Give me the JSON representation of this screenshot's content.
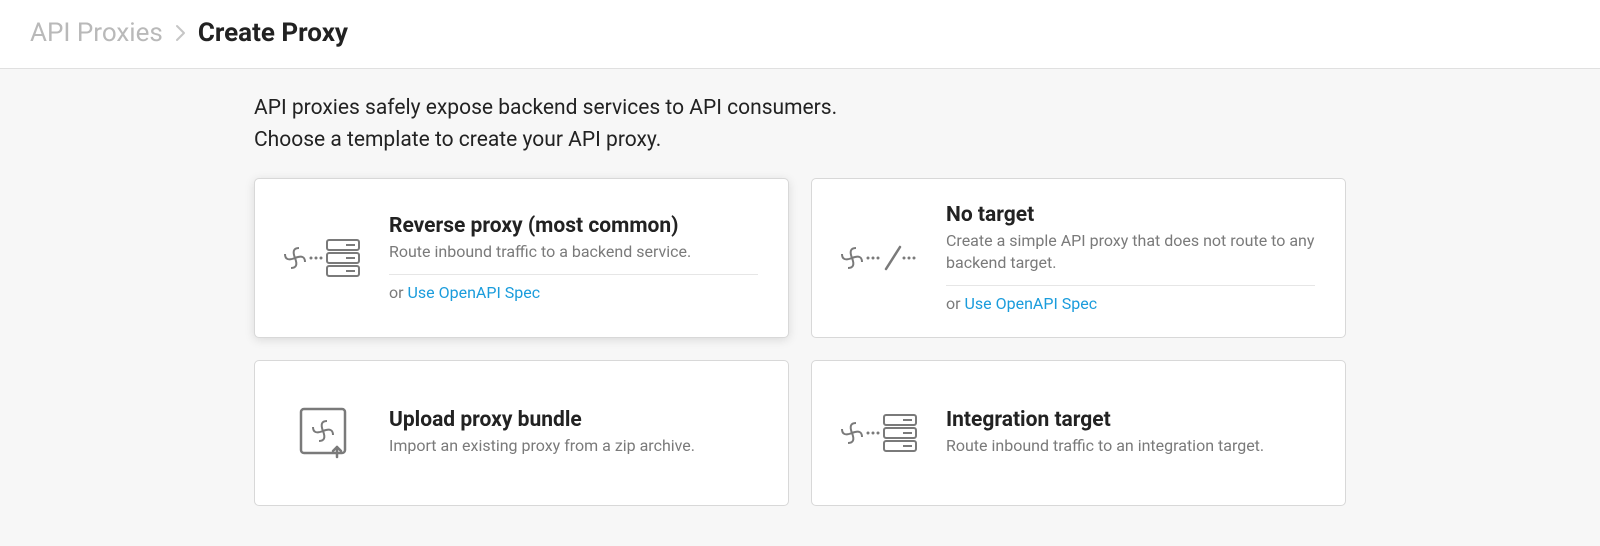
{
  "breadcrumb": {
    "parent": "API Proxies",
    "current": "Create Proxy"
  },
  "intro": {
    "line1": "API proxies safely expose backend services to API consumers.",
    "line2": "Choose a template to create your API proxy."
  },
  "cards": {
    "reverse_proxy": {
      "title": "Reverse proxy (most common)",
      "desc": "Route inbound traffic to a backend service.",
      "or_text": "or ",
      "link": "Use OpenAPI Spec"
    },
    "no_target": {
      "title": "No target",
      "desc": "Create a simple API proxy that does not route to any backend target.",
      "or_text": "or ",
      "link": "Use OpenAPI Spec"
    },
    "upload_bundle": {
      "title": "Upload proxy bundle",
      "desc": "Import an existing proxy from a zip archive."
    },
    "integration_target": {
      "title": "Integration target",
      "desc": "Route inbound traffic to an integration target."
    }
  }
}
